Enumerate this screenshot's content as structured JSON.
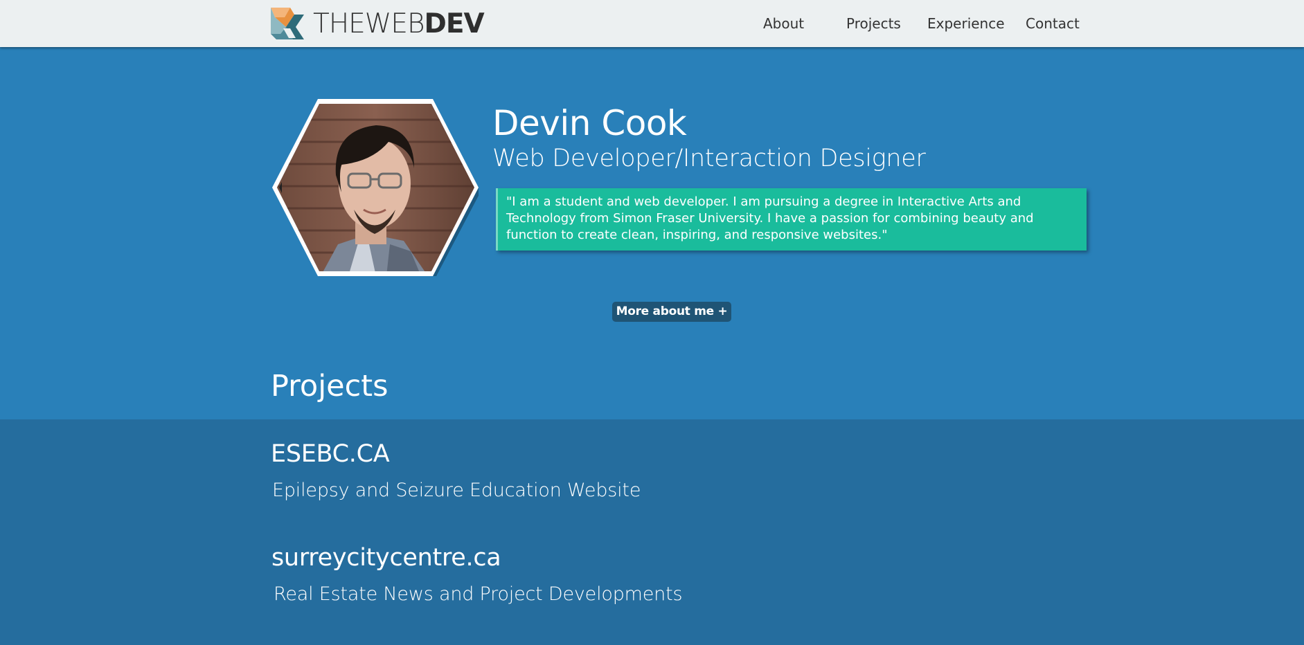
{
  "header": {
    "logo": {
      "text_light": "THEWEB",
      "text_bold": "DEV"
    },
    "nav": {
      "about": "About",
      "projects": "Projects",
      "experience": "Experience",
      "contact": "Contact"
    }
  },
  "hero": {
    "name": "Devin Cook",
    "role": "Web Developer/Interaction Designer",
    "quote": "\"I am a student and web developer. I am pursuing a degree in Interactive Arts and Technology from Simon Fraser University. I have a passion for combining beauty and function to create clean, inspiring, and responsive websites.\"",
    "more_button": "More about me +"
  },
  "projects": {
    "heading": "Projects",
    "items": [
      {
        "title": "ESEBC.CA",
        "description": "Epilepsy and Seizure Education Website"
      },
      {
        "title": "surreycitycentre.ca",
        "description": "Real Estate News and Project Developments"
      }
    ]
  },
  "colors": {
    "header_bg": "#ecf0f1",
    "hero_bg": "#2980b9",
    "projects_bg": "#256d9e",
    "quote_bg": "#1abc9c",
    "button_bg": "#1f5475",
    "logo_orange": "#f2a65a",
    "logo_teal": "#5b9aa8"
  }
}
